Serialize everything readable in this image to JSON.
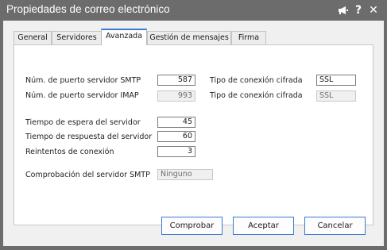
{
  "window": {
    "title": "Propiedades de correo electrónico",
    "help_label": "?",
    "close_label": "✕",
    "pin_label": "📢"
  },
  "tabs": [
    {
      "label": "General"
    },
    {
      "label": "Servidores"
    },
    {
      "label": "Avanzada"
    },
    {
      "label": "Gestión de mensajes"
    },
    {
      "label": "Firma"
    }
  ],
  "smtp": {
    "port_label": "Núm. de puerto servidor SMTP",
    "port_value": "587",
    "enc_label": "Tipo de conexión cifrada",
    "enc_value": "SSL"
  },
  "imap": {
    "port_label": "Núm. de puerto servidor IMAP",
    "port_value": "993",
    "enc_label": "Tipo de conexión cifrada",
    "enc_value": "SSL"
  },
  "timeouts": {
    "wait_label": "Tiempo de espera del servidor",
    "wait_value": "45",
    "response_label": "Tiempo de respuesta del servidor",
    "response_value": "60",
    "retries_label": "Reintentos de conexión",
    "retries_value": "3"
  },
  "smtp_check": {
    "label": "Comprobación del servidor SMTP",
    "value": "Ninguno"
  },
  "buttons": {
    "check": "Comprobar",
    "accept": "Aceptar",
    "cancel": "Cancelar"
  },
  "colors": {
    "titlebar": "#6c6c6c",
    "accent": "#3b7bd4"
  }
}
